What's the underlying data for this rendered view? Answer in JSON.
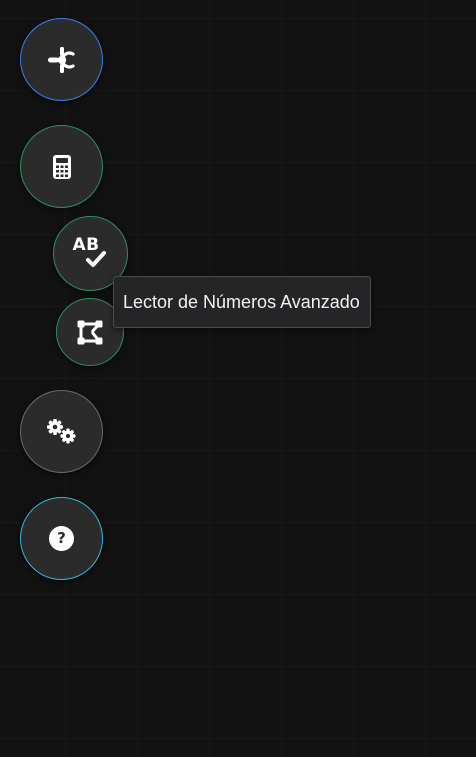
{
  "tooltip": {
    "text": "Lector de Números Avanzado"
  },
  "help_glyph": "?",
  "buttons": [
    {
      "id": "tools",
      "icon": "tools-icon",
      "ring_color": "#3d7de8"
    },
    {
      "id": "calculator",
      "icon": "calculator-icon",
      "ring_color": "#2f8f5a"
    },
    {
      "id": "spell-check",
      "icon": "spell-check-icon",
      "glyph": "AB",
      "ring_color": "#2f8f5a"
    },
    {
      "id": "shape-select",
      "icon": "bezier-shape-icon",
      "ring_color": "#2f8f5a"
    },
    {
      "id": "settings",
      "icon": "gears-icon",
      "ring_color": "#6a6a6a"
    },
    {
      "id": "help",
      "icon": "question-circle-icon",
      "ring_color": "#2fb8d6"
    }
  ]
}
